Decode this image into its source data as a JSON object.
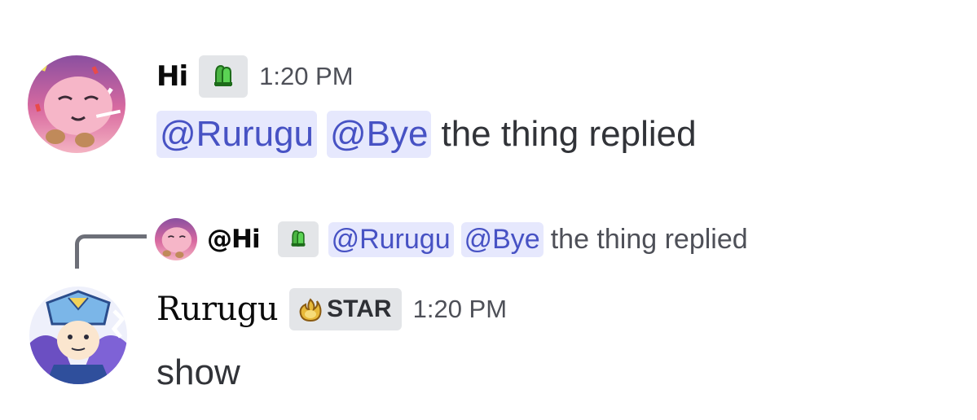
{
  "messages": [
    {
      "author": "Hi",
      "author_tag_icon": "green-hands-icon",
      "timestamp": "1:20 PM",
      "content": {
        "mentions": [
          "@Rurugu",
          "@Bye"
        ],
        "text": "the thing replied"
      }
    },
    {
      "reply_to": {
        "author": "@Hi",
        "tag_icon": "green-hands-icon",
        "mentions": [
          "@Rurugu",
          "@Bye"
        ],
        "text": "the thing replied"
      },
      "author": "Rurugu",
      "author_tag": {
        "icon": "gold-flame-icon",
        "label": "STAR"
      },
      "timestamp": "1:20 PM",
      "content": {
        "text": "show"
      }
    }
  ],
  "colors": {
    "mention_bg": "#e6e8fd",
    "mention_text": "#4752c4",
    "tag_bg": "#e3e5e8",
    "timestamp": "#4e5058",
    "body_text": "#313338"
  }
}
